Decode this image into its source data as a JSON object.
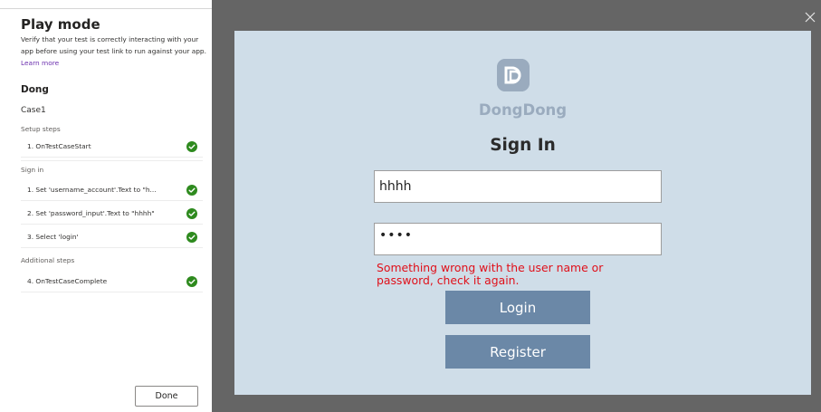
{
  "panel": {
    "title": "Play mode",
    "description": "Verify that your test is correctly interacting with your app before using your test link to run against your app.",
    "learn_more": "Learn more",
    "app_name": "Dong",
    "case_name": "Case1",
    "sections": [
      {
        "label": "Setup steps",
        "steps": [
          {
            "label": "1. OnTestCaseStart",
            "status": "passed"
          }
        ]
      },
      {
        "label": "Sign in",
        "steps": [
          {
            "label": "1. Set 'username_account'.Text to \"h...",
            "status": "passed"
          },
          {
            "label": "2. Set 'password_input'.Text to \"hhhh\"",
            "status": "passed"
          },
          {
            "label": "3. Select 'login'",
            "status": "passed"
          }
        ]
      },
      {
        "label": "Additional steps",
        "steps": [
          {
            "label": "4. OnTestCaseComplete",
            "status": "passed"
          }
        ]
      }
    ],
    "done_label": "Done"
  },
  "stage": {
    "close_icon": "close-icon"
  },
  "app": {
    "logo_icon": "dongdong-logo-icon",
    "brand": "DongDong",
    "title": "Sign In",
    "username_value": "hhhh",
    "password_mask": "••••",
    "error": "Something wrong with the user name or password, check it again.",
    "login_label": "Login",
    "register_label": "Register"
  },
  "colors": {
    "check_green": "#2e8a1e",
    "stage_bg": "#656565",
    "canvas_bg": "#cfdde8",
    "button_bg": "#6b88a7",
    "error_red": "#e0101a",
    "brand_muted": "#9aabbe"
  }
}
